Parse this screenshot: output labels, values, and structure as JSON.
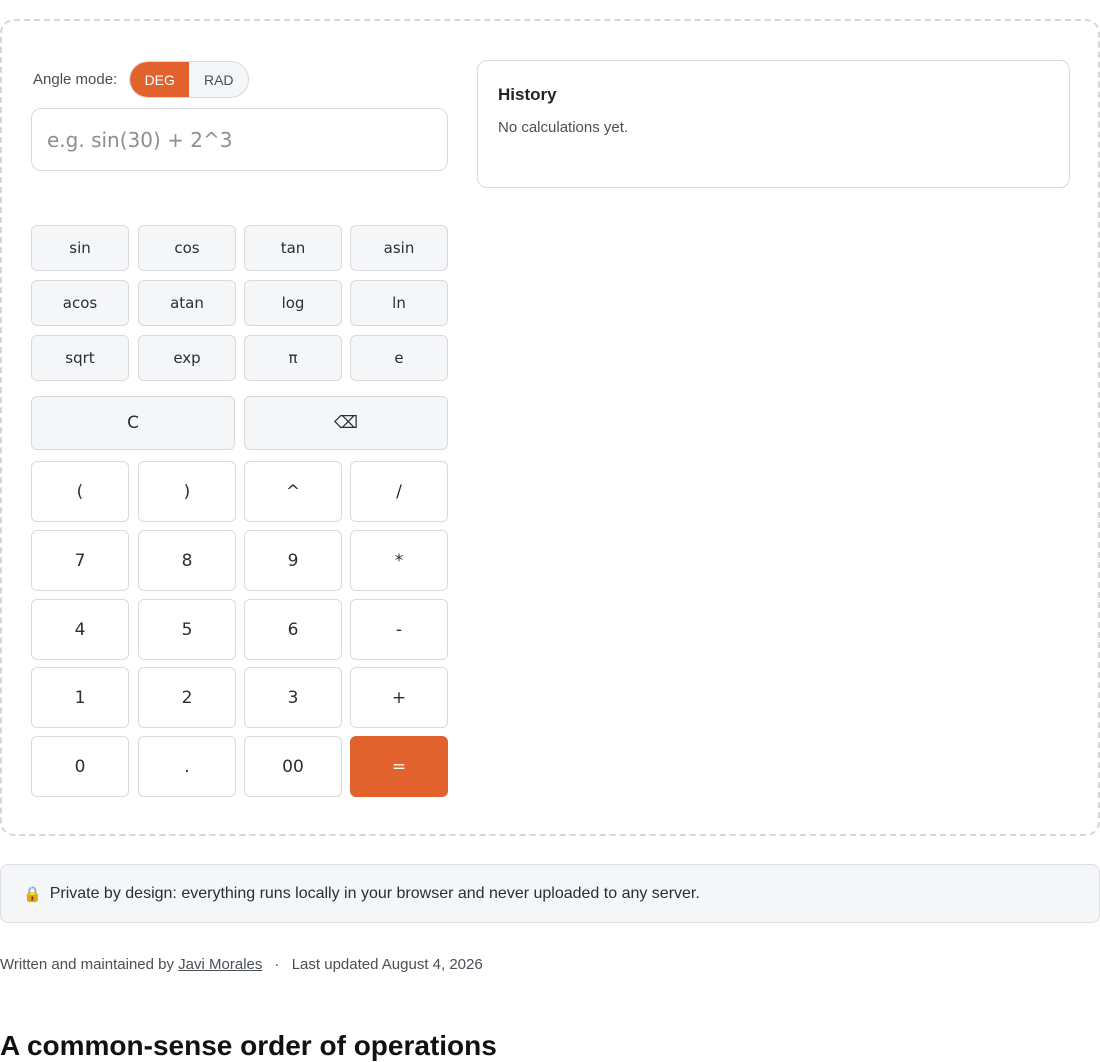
{
  "angle_mode": {
    "label": "Angle mode:",
    "options": [
      "DEG",
      "RAD"
    ],
    "selected": "DEG"
  },
  "expression": {
    "value": "",
    "placeholder": "e.g. sin(30) + 2^3"
  },
  "keys": {
    "functions": [
      "sin",
      "cos",
      "tan",
      "asin",
      "acos",
      "atan",
      "log",
      "ln",
      "sqrt",
      "exp",
      "π",
      "e"
    ],
    "clear": "C",
    "backspace": "⌫",
    "operators_row": [
      "(",
      ")",
      "^",
      "/"
    ],
    "row_789": [
      "7",
      "8",
      "9",
      "*"
    ],
    "row_456": [
      "4",
      "5",
      "6",
      "-"
    ],
    "row_123": [
      "1",
      "2",
      "3",
      "+"
    ],
    "row_0": [
      "0",
      ".",
      "00"
    ],
    "equals": "="
  },
  "history": {
    "title": "History",
    "empty_text": "No calculations yet."
  },
  "privacy": {
    "icon": "lock-icon",
    "icon_glyph": "🔒",
    "text": "Private by design: everything runs locally in your browser and never uploaded to any server."
  },
  "byline": {
    "prefix": "Written and maintained by",
    "author": "Javi Morales",
    "separator": "·",
    "updated": "Last updated August 4, 2026"
  },
  "next_section": {
    "heading": "A common-sense order of operations"
  },
  "colors": {
    "accent": "#e2622e",
    "key_fill": "#f5f6f7",
    "border": "#d8dadd"
  }
}
